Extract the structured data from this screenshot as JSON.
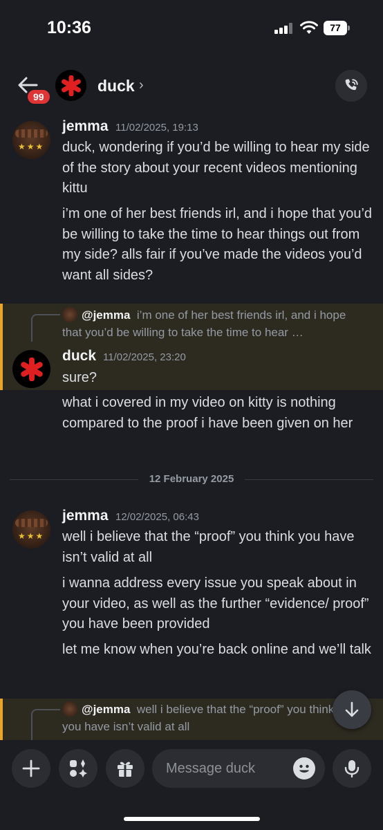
{
  "status_bar": {
    "time": "10:36",
    "battery": "77"
  },
  "header": {
    "back_badge": "99",
    "channel_name": "duck",
    "chevron": "›"
  },
  "messages": [
    {
      "user": "jemma",
      "timestamp": "11/02/2025, 19:13",
      "lines": [
        "duck, wondering if you’d be willing to hear my side of the story about your recent videos mentioning kittu",
        "i’m one of her best friends irl, and i hope that you’d be willing to take the time to hear things out from my side? alls fair if you’ve made the videos you’d want all sides?"
      ]
    },
    {
      "reply_to": {
        "mention": "@jemma",
        "text": "i’m one of her best friends irl, and i hope that you’d be willing to take the time to hear …"
      },
      "user": "duck",
      "timestamp": "11/02/2025, 23:20",
      "lines": [
        "sure?",
        "what i covered in my video on kitty is nothing compared to the proof i have been given on her"
      ]
    },
    {
      "user": "jemma",
      "timestamp": "12/02/2025, 06:43",
      "lines": [
        "well i believe that the “proof” you think you have isn’t valid at all",
        "i wanna address every issue you speak about in your video, as well as the further “evidence/ proof” you have been provided",
        "let me know when you’re back online and we’ll talk"
      ]
    },
    {
      "reply_to": {
        "mention": "@jemma",
        "text": "well i believe that the “proof” you think you have isn’t valid at all"
      }
    }
  ],
  "date_divider": "12 February 2025",
  "composer": {
    "placeholder": "Message duck"
  },
  "colors": {
    "background": "#1c1d22",
    "mention_highlight": "#e8a529",
    "badge": "#e03535",
    "duck_avatar_star": "#e02020"
  }
}
